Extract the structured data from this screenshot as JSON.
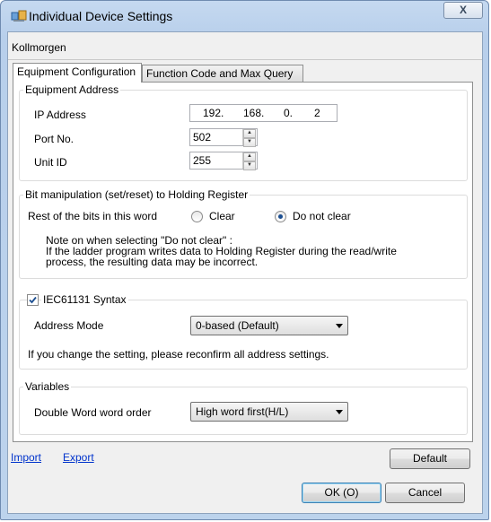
{
  "window": {
    "title": "Individual Device Settings",
    "close_glyph": "X"
  },
  "device_name": "Kollmorgen",
  "tabs": [
    {
      "label": "Equipment Configuration",
      "active": true
    },
    {
      "label": "Function Code and Max Query",
      "active": false
    }
  ],
  "equipment_address": {
    "group_title": "Equipment Address",
    "ip_label": "IP Address",
    "ip": [
      "192.",
      "168.",
      "0.",
      "2"
    ],
    "port_label": "Port No.",
    "port_value": "502",
    "unit_label": "Unit ID",
    "unit_value": "255"
  },
  "bit_manipulation": {
    "group_title": "Bit manipulation (set/reset) to Holding Register",
    "rest_label": "Rest of the bits in this word",
    "option_clear": "Clear",
    "option_do_not_clear": "Do not clear",
    "selected": "Do not clear",
    "note_line1": "Note on when selecting \"Do not clear\" :",
    "note_line2": "If the ladder program writes data to Holding Register during the read/write",
    "note_line3": "process, the resulting data may be incorrect."
  },
  "iec": {
    "checkbox_label": "IEC61131 Syntax",
    "checked": true,
    "address_mode_label": "Address Mode",
    "address_mode_value": "0-based (Default)",
    "warning": "If you change the setting, please reconfirm all address settings."
  },
  "variables": {
    "group_title": "Variables",
    "dword_label": "Double Word word order",
    "dword_value": "High word first(H/L)"
  },
  "footer": {
    "import_label": "Import",
    "export_label": "Export",
    "default_label": "Default",
    "ok_label": "OK (O)",
    "cancel_label": "Cancel"
  },
  "colors": {
    "link": "#0033cc",
    "frame": "#bcd3ec",
    "accent": "#1b4e91"
  }
}
